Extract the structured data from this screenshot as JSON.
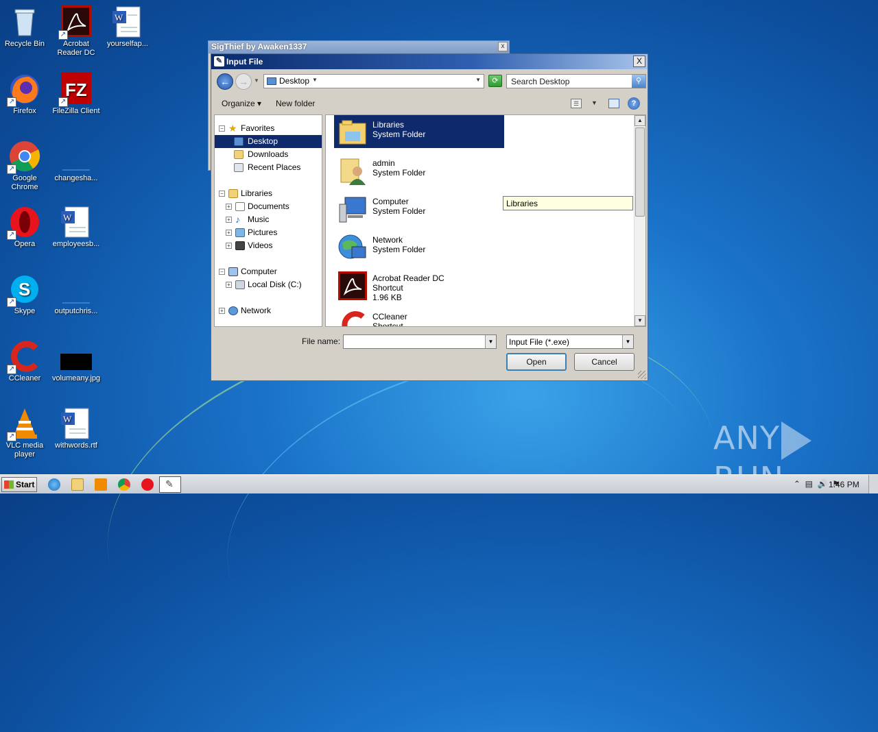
{
  "desktop": {
    "icons": [
      {
        "label": "Recycle Bin"
      },
      {
        "label": "Acrobat Reader DC"
      },
      {
        "label": "yourselfap..."
      },
      {
        "label": "Firefox"
      },
      {
        "label": "FileZilla Client"
      },
      {
        "label": "Google Chrome"
      },
      {
        "label": "changesha..."
      },
      {
        "label": "Opera"
      },
      {
        "label": "employeesb..."
      },
      {
        "label": "Skype"
      },
      {
        "label": "outputchris..."
      },
      {
        "label": "CCleaner"
      },
      {
        "label": "volumeany.jpg"
      },
      {
        "label": "VLC media player"
      },
      {
        "label": "withwords.rtf"
      }
    ]
  },
  "background_window": {
    "title": "SigThief by Awaken1337",
    "close": "x"
  },
  "dialog": {
    "title": "Input File",
    "close": "X",
    "address": {
      "location": "Desktop"
    },
    "search": {
      "placeholder": "Search Desktop"
    },
    "toolbar": {
      "organize": "Organize",
      "new_folder": "New folder",
      "help": "?"
    },
    "nav_tree": [
      {
        "label": "Favorites"
      },
      {
        "label": "Desktop",
        "selected": true
      },
      {
        "label": "Downloads"
      },
      {
        "label": "Recent Places"
      },
      {
        "label": "Libraries"
      },
      {
        "label": "Documents"
      },
      {
        "label": "Music"
      },
      {
        "label": "Pictures"
      },
      {
        "label": "Videos"
      },
      {
        "label": "Computer"
      },
      {
        "label": "Local Disk (C:)"
      },
      {
        "label": "Network"
      }
    ],
    "files": [
      {
        "name": "Libraries",
        "type": "System Folder",
        "size": "",
        "selected": true
      },
      {
        "name": "admin",
        "type": "System Folder",
        "size": ""
      },
      {
        "name": "Computer",
        "type": "System Folder",
        "size": ""
      },
      {
        "name": "Network",
        "type": "System Folder",
        "size": ""
      },
      {
        "name": "Acrobat Reader DC",
        "type": "Shortcut",
        "size": "1.96 KB"
      },
      {
        "name": "CCleaner",
        "type": "Shortcut",
        "size": ""
      }
    ],
    "tooltip": "Libraries",
    "file_name_label": "File name:",
    "file_name_value": "",
    "filter": "Input File  (*.exe)",
    "open_label": "Open",
    "cancel_label": "Cancel"
  },
  "watermark": {
    "left": "ANY",
    "right": "RUN"
  },
  "taskbar": {
    "start_label": "Start",
    "clock": "1:46 PM"
  },
  "colors": {
    "selection": "#0f2a6b",
    "desktop": "#1a73c9",
    "dialog_face": "#d4d0c8"
  }
}
